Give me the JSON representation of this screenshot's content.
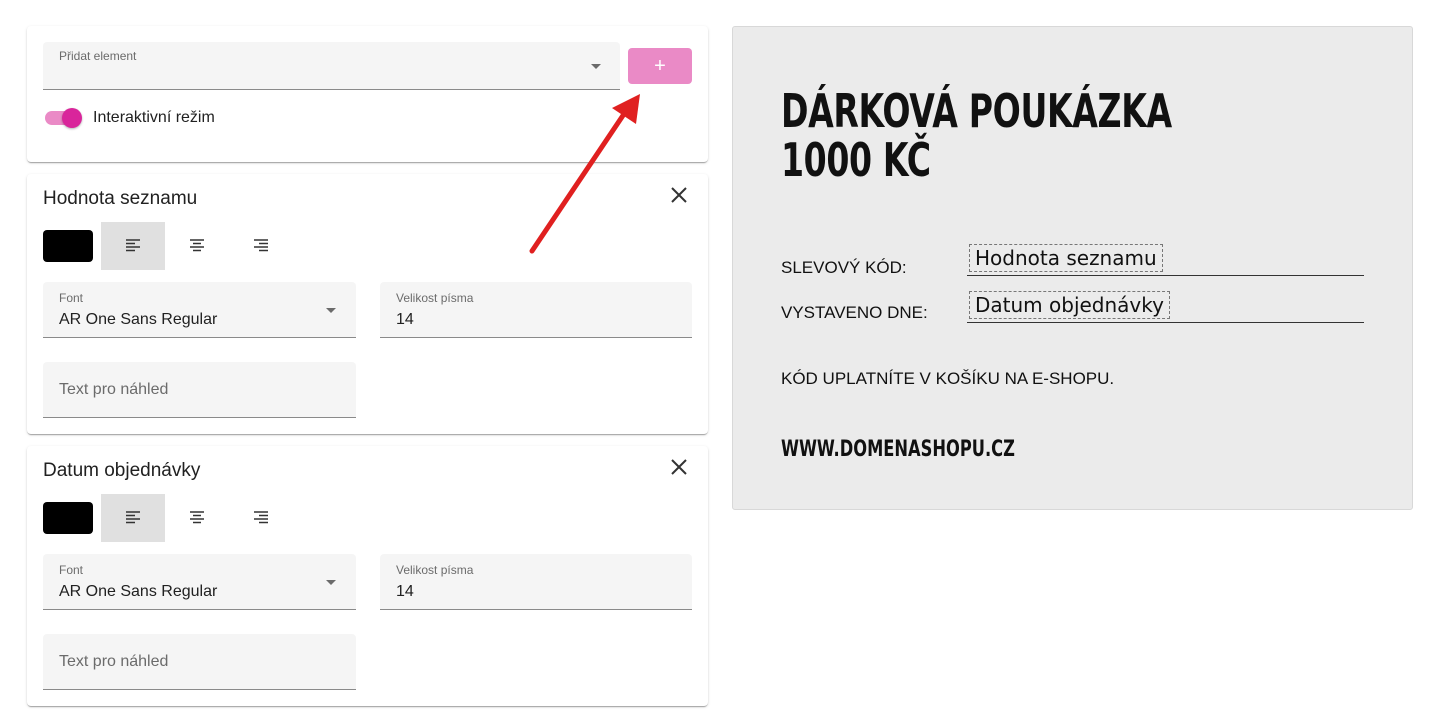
{
  "toolbar": {
    "add_element_label": "Přidat element",
    "add_button_label": "+",
    "interactive_mode_label": "Interaktivní režim",
    "interactive_mode_on": true
  },
  "accent_colors": {
    "primary": "#d9259b",
    "primary_light": "#ea8ac6",
    "annotation_arrow": "#e02020"
  },
  "elements": [
    {
      "title": "Hodnota seznamu",
      "color": "#000000",
      "alignment_options": [
        "align-left-icon",
        "align-center-icon",
        "align-right-icon"
      ],
      "selected_alignment": "left",
      "font_label": "Font",
      "font_value": "AR One Sans Regular",
      "size_label": "Velikost písma",
      "size_value": "14",
      "preview_placeholder": "Text pro náhled"
    },
    {
      "title": "Datum objednávky",
      "color": "#000000",
      "alignment_options": [
        "align-left-icon",
        "align-center-icon",
        "align-right-icon"
      ],
      "selected_alignment": "left",
      "font_label": "Font",
      "font_value": "AR One Sans Regular",
      "size_label": "Velikost písma",
      "size_value": "14",
      "preview_placeholder": "Text pro náhled"
    }
  ],
  "voucher": {
    "title_line1": "DÁRKOVÁ POUKÁZKA",
    "title_line2": "1000 KČ",
    "code_label": "SLEVOVÝ KÓD:",
    "code_field": "Hodnota seznamu",
    "date_label": "VYSTAVENO DNE:",
    "date_field": "Datum objednávky",
    "note": "KÓD UPLATNÍTE V KOŠÍKU NA E-SHOPU.",
    "url": "WWW.DOMENASHOPU.CZ"
  }
}
